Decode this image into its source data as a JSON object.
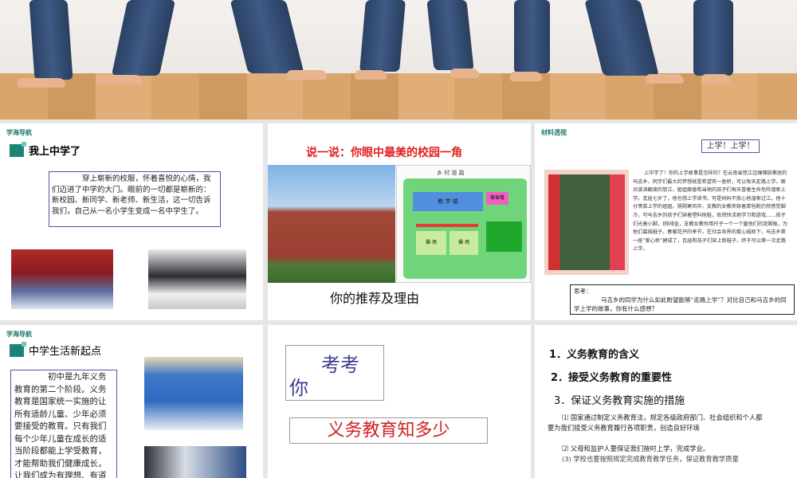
{
  "slides": [
    {
      "nav": "学海导航",
      "heading": "我上中学了",
      "text": "穿上崭新的校服，怀着喜悦的心情，我们迈进了中学的大门。眼前的一切都是崭新的：新校园、新同学、新老师、新生活，这一切告诉我们，自己从一名小学生变成一名中学生了。"
    },
    {
      "title": "说一说：你眼中最美的校园一角",
      "map_road": "乡 村 道 路",
      "map_building": "教 学 楼",
      "map_dorm": "宿舍楼",
      "map_field": "操 场",
      "caption": "你的推荐及理由"
    },
    {
      "nav": "材料透视",
      "title": "上学！上学！",
      "story": "上中学了！你的上学故事是怎样的？在云南省怒江边傈僳族聚居的马吉乡，同学们最大的梦想就是希望有一座桥，可以每天走路上学。面对波涛翻滚的怒江，姐姐娜香和当地的孩子们每天冒着生命危险溜索上学。瓦娃七岁了，他也想上学读书，可是妈妈不放心他溜索过江。他十分羡慕上学的姐姐。朔朔寒风中，支教的女教师穿着厚毡靴仍然感觉脚冷，可马吉乡的孩子们穿着塑料拖鞋，依然快活地学习和游戏……孩子们光着小脚，f排排坐，支教女教师用尺子一个一个量他们的泥脚板，为他们募捐鞋子。春暖花开的季节，在社会各界的爱心捐助下，马吉乡第一座“爱心桥”建成了，瓦娃和孩子们穿上新鞋子，终于可以第一次走路上学。",
      "think_label": "思考：",
      "think_text": "马吉乡的同学为什么如此盼望能够“走路上学”？对比自己和马吉乡的同学上学的故事，你有什么感想？"
    },
    {
      "nav": "学海导航",
      "heading": "中学生活新起点",
      "text": "初中是九年义务教育的第二个阶段。义务教育是国家统一实施的让所有适龄儿童、少年必须要接受的教育。只有我们每个少年儿童在成长的适当阶段都能上学受教育，才能帮助我们健康成长，让我们成为有理想、有道德、有文化、有纪律的人"
    },
    {
      "quiz_a": "考考",
      "quiz_b": "你",
      "topic": "义务教育知多少"
    },
    {
      "items": [
        "1．义务教育的含义",
        "2．接受义务教育的重要性",
        "3．保证义务教育实施的措施"
      ],
      "points": [
        "⑴ 国家通过制定义务教育法，规定各级政府部门、社会组织和个人都要为我们接受义务教育履行各项职责，创造良好环境",
        "⑵ 父母和监护人要保证我们按时上学，完成学业。",
        "(3) 学校也要按照规定完成教育教学任务，保证教育教学质量"
      ]
    }
  ]
}
